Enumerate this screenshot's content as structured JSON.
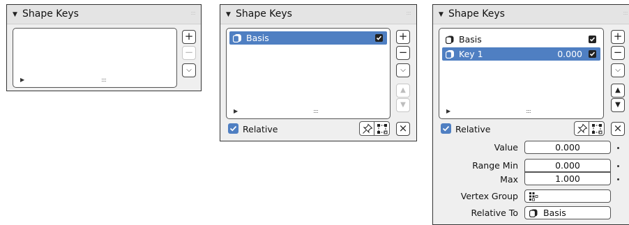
{
  "panels": [
    {
      "title": "Shape Keys",
      "items": [],
      "side_buttons": {
        "add": "+",
        "remove": "−",
        "menu": "⌵"
      }
    },
    {
      "title": "Shape Keys",
      "items": [
        {
          "name": "Basis",
          "selected": true,
          "checked": true
        }
      ],
      "side_buttons": {
        "add": "+",
        "remove": "−",
        "menu": "⌵",
        "move_up": "▲",
        "move_down": "▼",
        "clear": "×"
      },
      "relative": {
        "label": "Relative",
        "checked": true
      }
    },
    {
      "title": "Shape Keys",
      "items": [
        {
          "name": "Basis",
          "selected": false,
          "checked": true
        },
        {
          "name": "Key 1",
          "value": "0.000",
          "selected": true,
          "checked": true
        }
      ],
      "side_buttons": {
        "add": "+",
        "remove": "−",
        "menu": "⌵",
        "move_up": "▲",
        "move_down": "▼",
        "clear": "×"
      },
      "relative": {
        "label": "Relative",
        "checked": true
      },
      "properties": {
        "value": {
          "label": "Value",
          "value": "0.000"
        },
        "range_min": {
          "label": "Range Min",
          "value": "0.000"
        },
        "range_max": {
          "label": "Max",
          "value": "1.000"
        },
        "vertex_group": {
          "label": "Vertex Group",
          "value": ""
        },
        "relative_to": {
          "label": "Relative To",
          "value": "Basis"
        }
      }
    }
  ],
  "colors": {
    "selection": "#4f7fc2",
    "panel_bg": "#efefef",
    "header_bg": "#e4e4e4"
  }
}
